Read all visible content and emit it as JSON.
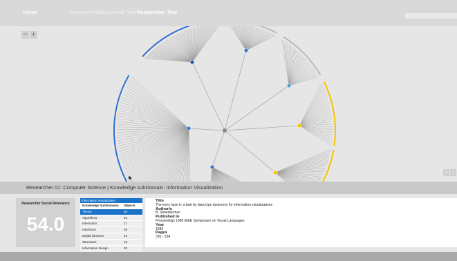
{
  "nav": {
    "home": "Home",
    "item2": "Researchers",
    "item3": "Researcher Tree",
    "active": "Researcher Tree"
  },
  "search": {
    "placeholder": ""
  },
  "zoom": {
    "minus": "−",
    "plus": "+"
  },
  "pager": {
    "prev": "‹",
    "next": "›"
  },
  "breadcrumb": "Researcher 01: Computer Science | Knowledge subDomain: Information Visualization",
  "relevance": {
    "title": "Researcher Social Relevance",
    "value": "54.0"
  },
  "domain_table": {
    "header": "Information Visualization",
    "col1": "Knowledge SubDomains",
    "col2": "Objects",
    "rows": [
      {
        "name": "Theory",
        "count": "55",
        "selected": true
      },
      {
        "name": "Algorithms",
        "count": "33",
        "selected": false
      },
      {
        "name": "Interaction",
        "count": "17",
        "selected": false
      },
      {
        "name": "Interfaces",
        "count": "38",
        "selected": false
      },
      {
        "name": "Digital Libraries",
        "count": "15",
        "selected": false
      },
      {
        "name": "Structures",
        "count": "10",
        "selected": false
      },
      {
        "name": "Information Design",
        "count": "20",
        "selected": false
      }
    ]
  },
  "paper": {
    "title_label": "Title",
    "title": "The eyes have it: a task by data type taxonomy for information visualizations",
    "authors_label": "Author/s",
    "authors": "B. Shneiderman",
    "published_label": "Published in",
    "published": "Proceedings 1996 IEEE Symposium on Visual Languages",
    "year_label": "Year",
    "year": "1996",
    "pages_label": "Pages",
    "pages": "336 - 334"
  },
  "colors": {
    "accent_blue": "#1a73c8",
    "accent_yellow": "#f5c400",
    "center_node": "#8a8a8a",
    "link": "#aaaaaa"
  },
  "tree": {
    "branches": [
      {
        "node_color": "blue-dark",
        "leaves": 60,
        "arc": "blue",
        "arc_label": ""
      },
      {
        "node_color": "blue",
        "leaves": 35,
        "arc": "grey",
        "arc_label": ""
      },
      {
        "node_color": "light-blue",
        "leaves": 25,
        "arc": "grey",
        "arc_label": ""
      },
      {
        "node_color": "yellow",
        "leaves": 25,
        "arc": "yellow",
        "arc_label": ""
      },
      {
        "node_color": "yellow",
        "leaves": 30,
        "arc": "yellow",
        "arc_label": ""
      },
      {
        "node_color": "blue",
        "leaves": 40,
        "arc": "grey",
        "arc_label": ""
      },
      {
        "node_color": "blue",
        "leaves": 70,
        "arc": "blue",
        "arc_label": ""
      }
    ]
  }
}
